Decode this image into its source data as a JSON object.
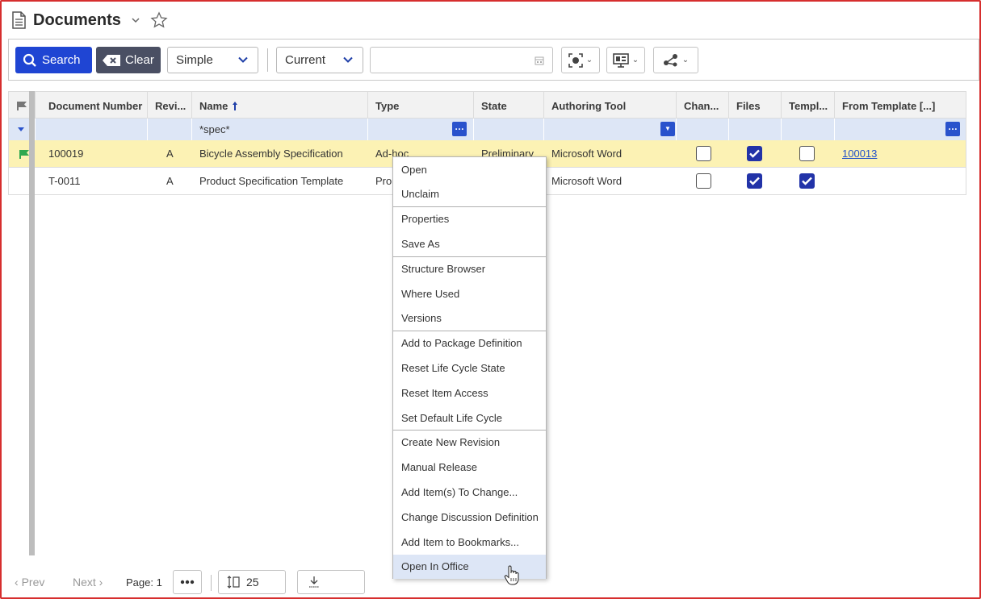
{
  "page": {
    "title": "Documents"
  },
  "toolbar": {
    "search_label": "Search",
    "clear_label": "Clear",
    "mode_value": "Simple",
    "revision_value": "Current",
    "date_value": ""
  },
  "grid": {
    "columns": [
      "Document Number",
      "Revi...",
      "Name",
      "Type",
      "State",
      "Authoring Tool",
      "Chan...",
      "Files",
      "Templ...",
      "From Template [...]"
    ],
    "sort_column": "Name",
    "sort_direction": "ascending",
    "filters": {
      "name": "*spec*"
    },
    "rows": [
      {
        "flagged": true,
        "selected": true,
        "document_number": "100019",
        "revision": "A",
        "name": "Bicycle Assembly Specification",
        "type": "Ad-hoc",
        "state": "Preliminary",
        "authoring_tool": "Microsoft Word",
        "change": false,
        "files": true,
        "template": false,
        "from_template": "100013"
      },
      {
        "flagged": false,
        "selected": false,
        "document_number": "T-0011",
        "revision": "A",
        "name": "Product Specification Template",
        "type": "Pro",
        "state": "",
        "authoring_tool": "Microsoft Word",
        "change": false,
        "files": true,
        "template": true,
        "from_template": ""
      }
    ]
  },
  "pager": {
    "prev_label": "Prev",
    "next_label": "Next",
    "page_label": "Page: 1",
    "page_size": "25"
  },
  "context_menu": {
    "groups": [
      [
        "Open",
        "Unclaim"
      ],
      [
        "Properties",
        "Save As"
      ],
      [
        "Structure Browser",
        "Where Used",
        "Versions"
      ],
      [
        "Add to Package Definition",
        "Reset Life Cycle State",
        "Reset Item Access",
        "Set Default Life Cycle"
      ],
      [
        "Create New Revision",
        "Manual Release",
        "Add Item(s) To Change...",
        "Change Discussion Definition",
        "Add Item to Bookmarks...",
        "Open In Office"
      ]
    ],
    "hovered_item": "Open In Office"
  },
  "colors": {
    "primary": "#1f45d3",
    "clear_button": "#4a4f63",
    "selected_row": "#fcf2b4",
    "filter_row": "#dde6f6",
    "checkbox_checked": "#2233a8",
    "flag_green": "#2fa84f",
    "window_border": "#d62e2e"
  },
  "icons": [
    "document-icon",
    "chevron-down-icon",
    "star-icon",
    "search-icon",
    "clear-icon",
    "calendar-icon",
    "target-icon",
    "monitor-icon",
    "share-icon",
    "flag-icon",
    "sort-up-icon",
    "download-icon",
    "page-size-icon",
    "more-icon",
    "hand-cursor-icon"
  ]
}
